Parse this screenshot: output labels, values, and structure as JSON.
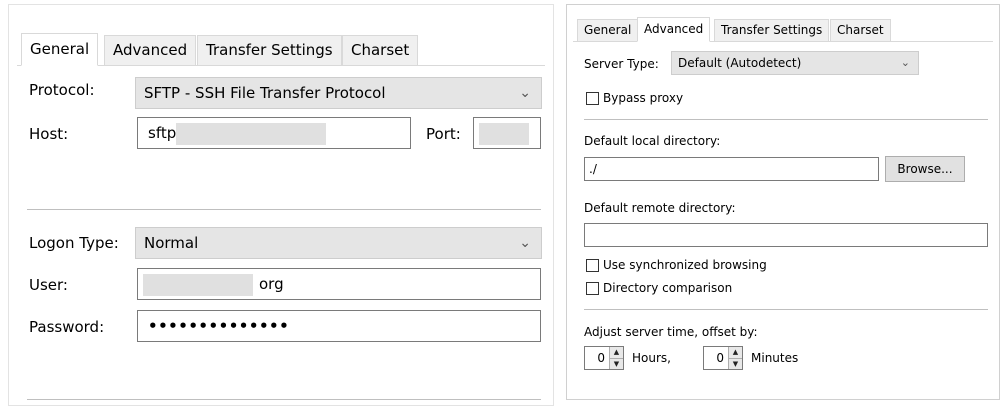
{
  "left": {
    "tabs": [
      {
        "label": "General",
        "selected": true
      },
      {
        "label": "Advanced",
        "selected": false
      },
      {
        "label": "Transfer Settings",
        "selected": false
      },
      {
        "label": "Charset",
        "selected": false
      }
    ],
    "protocol": {
      "label": "Protocol:",
      "value": "SFTP - SSH File Transfer Protocol"
    },
    "host": {
      "label": "Host:",
      "value_prefix": "sftp"
    },
    "port": {
      "label": "Port:",
      "value": ""
    },
    "logon_type": {
      "label": "Logon Type:",
      "value": "Normal"
    },
    "user": {
      "label": "User:",
      "value_suffix": "org"
    },
    "password": {
      "label": "Password:",
      "value": "••••••••••••••"
    }
  },
  "right": {
    "tabs": [
      {
        "label": "General",
        "selected": false
      },
      {
        "label": "Advanced",
        "selected": true
      },
      {
        "label": "Transfer Settings",
        "selected": false
      },
      {
        "label": "Charset",
        "selected": false
      }
    ],
    "server_type": {
      "label": "Server Type:",
      "value": "Default (Autodetect)"
    },
    "bypass_proxy": {
      "label": "Bypass proxy",
      "checked": false
    },
    "local_dir": {
      "label": "Default local directory:",
      "value": "./"
    },
    "browse_label": "Browse...",
    "remote_dir": {
      "label": "Default remote directory:",
      "value": ""
    },
    "sync_browsing": {
      "label": "Use synchronized browsing",
      "checked": false
    },
    "dir_comparison": {
      "label": "Directory comparison",
      "checked": false
    },
    "offset": {
      "label": "Adjust server time, offset by:",
      "hours_value": "0",
      "hours_label": "Hours,",
      "minutes_value": "0",
      "minutes_label": "Minutes"
    }
  },
  "icons": {
    "dropdown": "chevron-down-icon",
    "spin_up": "arrow-up-icon",
    "spin_down": "arrow-down-icon"
  }
}
